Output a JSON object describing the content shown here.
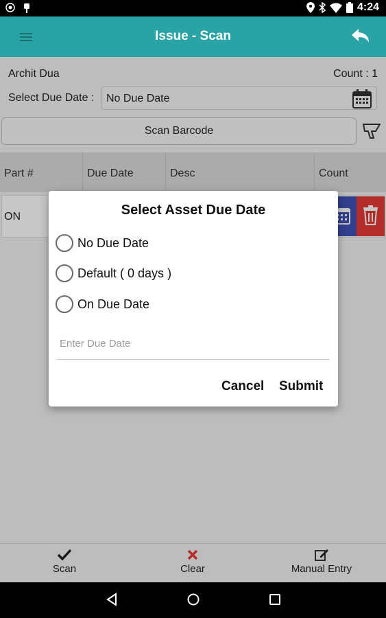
{
  "status_bar": {
    "time": "4:24"
  },
  "app_bar": {
    "title": "Issue - Scan"
  },
  "info": {
    "user_name": "Archit Dua",
    "count_text": "Count : 1",
    "due_date_label": "Select Due Date :",
    "due_date_value": "No Due Date"
  },
  "scan_barcode_label": "Scan Barcode",
  "table": {
    "headers": [
      "Part #",
      "Due Date",
      "Desc",
      "Count"
    ],
    "rows": [
      {
        "part": "ON"
      }
    ]
  },
  "dialog": {
    "title": "Select Asset Due Date",
    "options": [
      "No Due Date",
      "Default ( 0 days )",
      "On Due Date"
    ],
    "input_placeholder": "Enter Due Date",
    "cancel_label": "Cancel",
    "submit_label": "Submit"
  },
  "bottom_bar": {
    "scan_label": "Scan",
    "clear_label": "Clear",
    "manual_entry_label": "Manual Entry"
  },
  "colors": {
    "app_bar": "#2aa3a6",
    "row_calendar_button": "#3f51b5",
    "row_delete_button": "#e53935",
    "clear_icon": "#e53935"
  },
  "icons": [
    "menu-icon",
    "back-arrow-icon",
    "calendar-icon",
    "barcode-scanner-icon",
    "trash-icon",
    "check-icon",
    "close-icon",
    "edit-icon",
    "nav-back-icon",
    "nav-home-icon",
    "nav-recents-icon"
  ]
}
